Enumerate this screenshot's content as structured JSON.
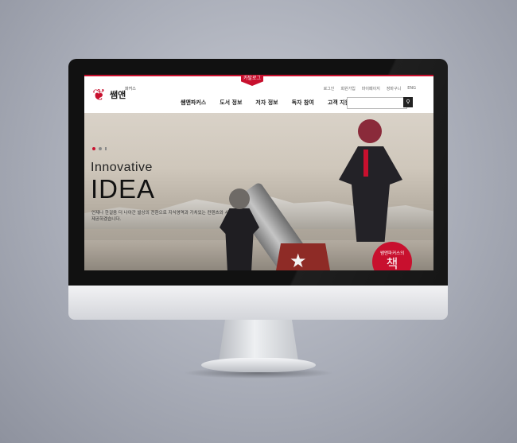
{
  "site": {
    "catalog_tab": "카탈로그",
    "logo_text": "쌤앤",
    "logo_sub": "파커스",
    "util_links": [
      "로그인",
      "회원가입",
      "마이페이지",
      "장바구니",
      "ENG"
    ],
    "nav": [
      "쌤앤파커스",
      "도서 정보",
      "저자 정보",
      "독자 참여",
      "고객 지원"
    ],
    "search_placeholder": "",
    "search_icon": "search-icon"
  },
  "hero": {
    "headline_small": "Innovative",
    "headline_large": "IDEA",
    "description": "언제나 한걸음 더 나아간 발상의 전환으로 지식영역과 가치있는 컨텐츠와 서비스를 제공하겠습니다.",
    "slides_total": 3,
    "slides_active": 1
  },
  "badge": {
    "top": "쌤앤파커스의",
    "main": "책"
  },
  "colors": {
    "accent": "#c8102e",
    "text_dark": "#222222"
  }
}
